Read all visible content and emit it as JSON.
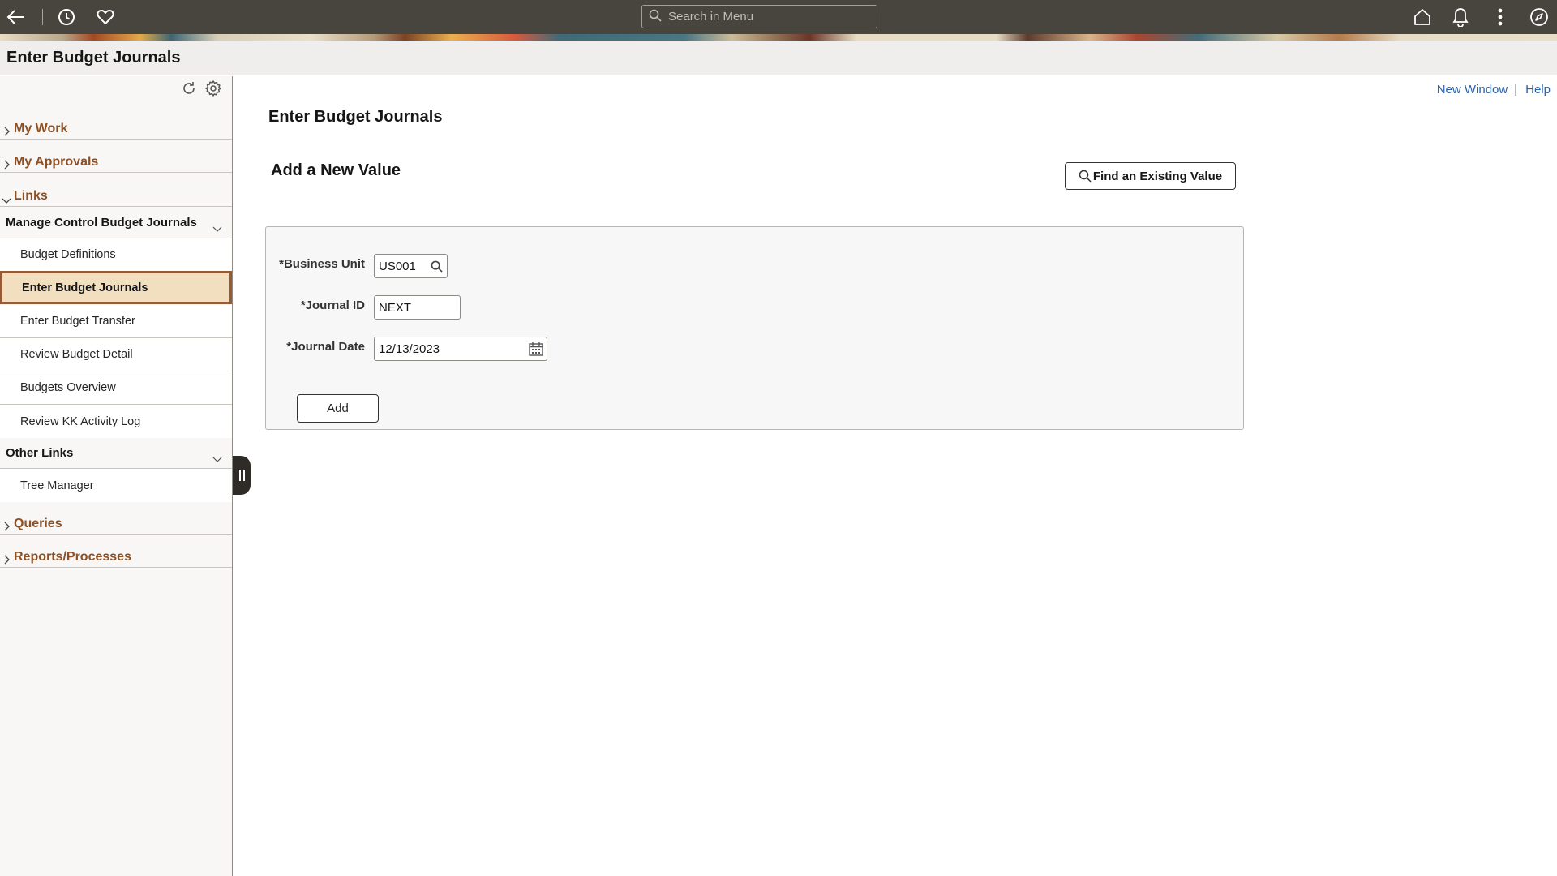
{
  "topbar": {
    "search_placeholder": "Search in Menu",
    "icons": [
      "back-arrow-icon",
      "history-icon",
      "favorites-heart-icon",
      "home-icon",
      "notifications-bell-icon",
      "actions-kebab-icon",
      "navigator-compass-icon"
    ]
  },
  "titlebar": {
    "title": "Enter Budget Journals"
  },
  "sidebar": {
    "sections_top": [
      {
        "label": "My Work",
        "state": "collapsed"
      },
      {
        "label": "My Approvals",
        "state": "collapsed"
      },
      {
        "label": "Links",
        "state": "expanded"
      }
    ],
    "groups": [
      {
        "label": "Manage Control Budget Journals",
        "items": [
          {
            "label": "Budget Definitions",
            "active": false
          },
          {
            "label": "Enter Budget Journals",
            "active": true
          },
          {
            "label": "Enter Budget Transfer",
            "active": false
          },
          {
            "label": "Review Budget Detail",
            "active": false
          },
          {
            "label": "Budgets Overview",
            "active": false
          },
          {
            "label": "Review KK Activity Log",
            "active": false
          }
        ]
      },
      {
        "label": "Other Links",
        "items": [
          {
            "label": "Tree Manager",
            "active": false
          }
        ]
      }
    ],
    "sections_bottom": [
      {
        "label": "Queries",
        "state": "collapsed"
      },
      {
        "label": "Reports/Processes",
        "state": "collapsed"
      }
    ]
  },
  "content": {
    "links": {
      "new_window": "New Window",
      "separator": "|",
      "help": "Help"
    },
    "page_heading": "Enter Budget Journals",
    "sub_heading": "Add a New Value",
    "find_button": "Find an Existing Value",
    "form": {
      "business_unit": {
        "label": "*Business Unit",
        "value": "US001"
      },
      "journal_id": {
        "label": "*Journal ID",
        "value": "NEXT"
      },
      "journal_date": {
        "label": "*Journal Date",
        "value": "12/13/2023"
      },
      "add_button": "Add"
    }
  },
  "colors": {
    "topbar": "#48443e",
    "section_label": "#8d4f24",
    "active_item_bg": "#f2dfbf",
    "active_item_border": "#955b36",
    "link": "#2c63b0"
  }
}
